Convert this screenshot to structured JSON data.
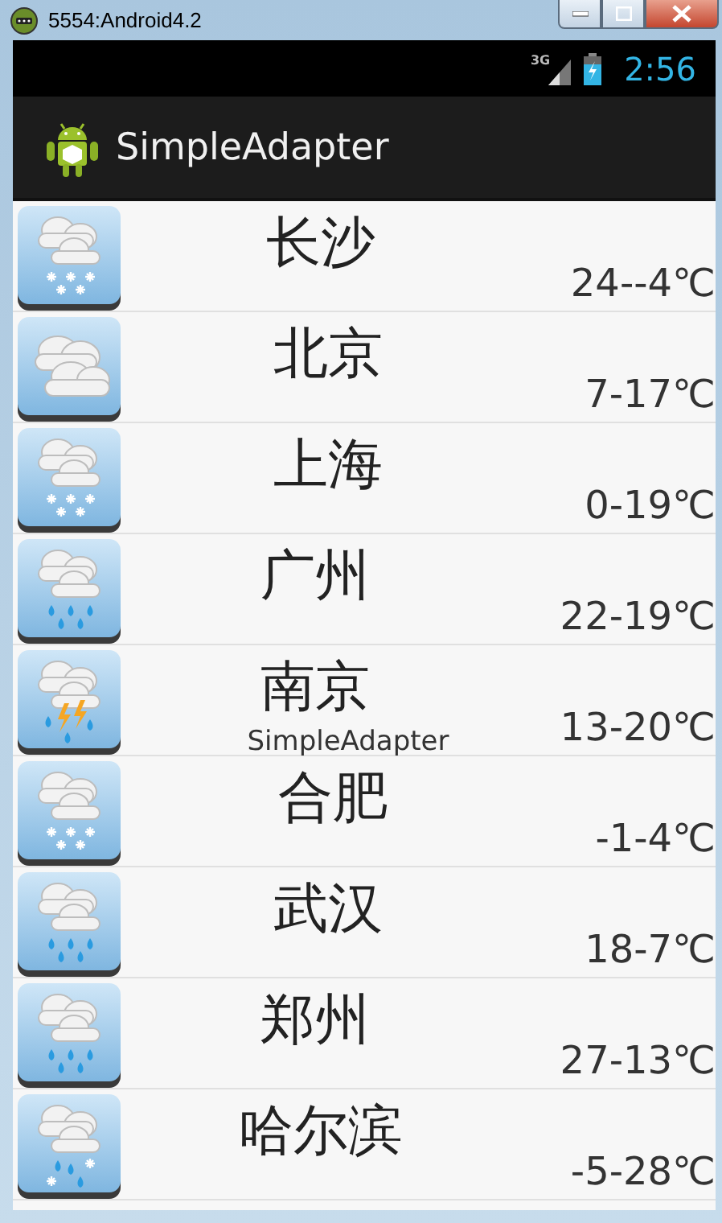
{
  "window": {
    "title": "5554:Android4.2"
  },
  "status_bar": {
    "network": "3G",
    "time": "2:56"
  },
  "action_bar": {
    "title": "SimpleAdapter"
  },
  "rows": [
    {
      "kind": "snow",
      "city": "长沙",
      "temperature": "24--4℃"
    },
    {
      "kind": "cloudy",
      "city": "北京",
      "temperature": "7-17℃"
    },
    {
      "kind": "snow",
      "city": "上海",
      "temperature": "0-19℃"
    },
    {
      "kind": "rain",
      "city": "广州",
      "temperature": "22-19℃"
    },
    {
      "kind": "thunder",
      "city": "南京",
      "temperature": "13-20℃"
    },
    {
      "kind": "snow",
      "city": "合肥",
      "temperature": "-1-4℃"
    },
    {
      "kind": "rain",
      "city": "武汉",
      "temperature": "18-7℃"
    },
    {
      "kind": "rain",
      "city": "郑州",
      "temperature": "27-13℃"
    },
    {
      "kind": "sleet",
      "city": "哈尔滨",
      "temperature": "-5-28℃"
    }
  ],
  "toast": {
    "text": "SimpleAdapter"
  }
}
